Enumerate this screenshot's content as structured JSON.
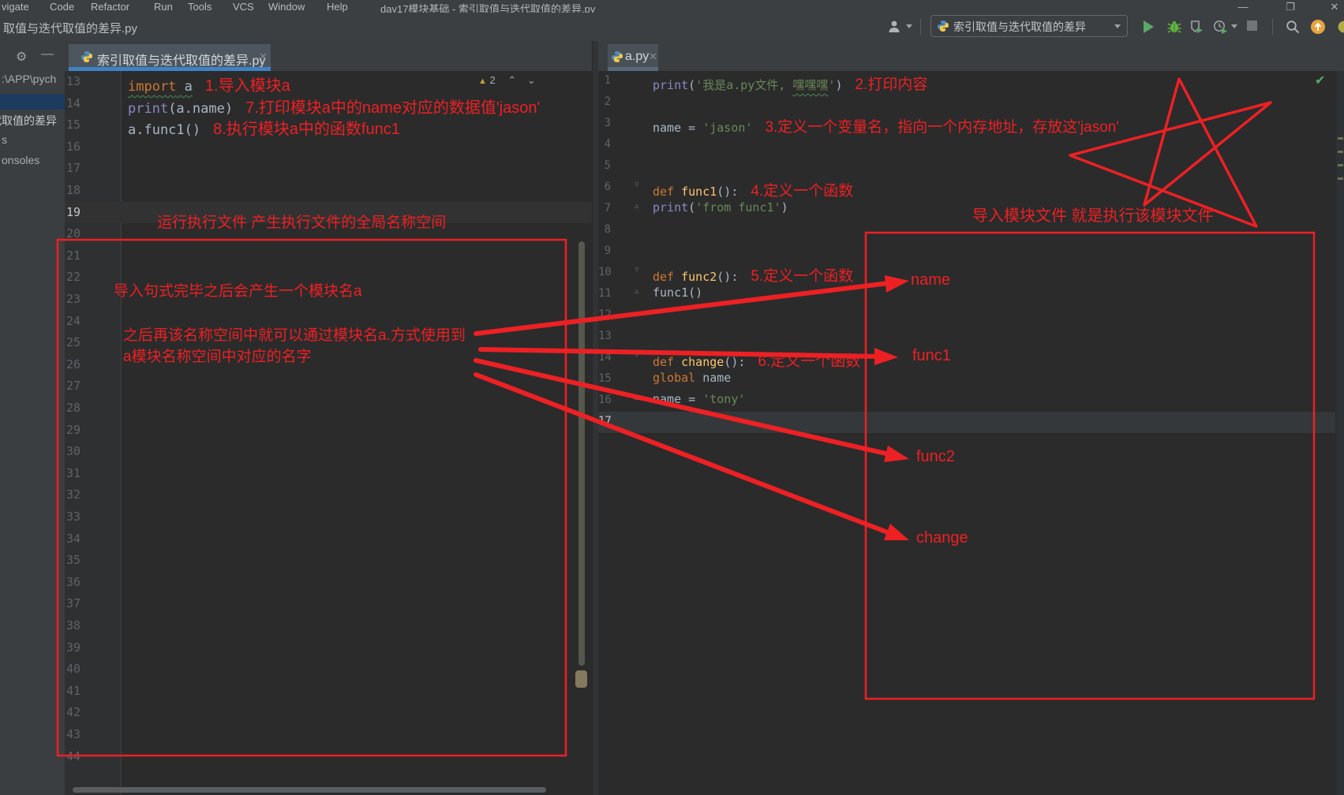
{
  "menu": {
    "items": [
      "vigate",
      "Code",
      "Refactor",
      "Run",
      "Tools",
      "VCS",
      "Window",
      "Help"
    ]
  },
  "window": {
    "title": "day17模块基础 - 索引取值与迭代取值的差异.py"
  },
  "toolbar": {
    "breadcrumb": "取值与迭代取值的差异.py",
    "run_config": "索引取值与迭代取值的差异"
  },
  "project": {
    "path": ":\\APP\\pych",
    "item_module": "代取值的差异",
    "item_s": "s",
    "item_consoles": "onsoles"
  },
  "tabs": {
    "left": "索引取值与迭代取值的差异.py",
    "right": "a.py"
  },
  "left_editor": {
    "warn_count": "2"
  },
  "red": {
    "run_note": "运行执行文件 产生执行文件的全局名称空间",
    "import_note": "导入句式完毕之后会产生一个模块名a",
    "use_note1": "之后再该名称空间中就可以通过模块名a.方式使用到",
    "use_note2": "a模块名称空间中对应的名字",
    "module_note": "导入模块文件 就是执行该模块文件",
    "label_name": "name",
    "label_func1": "func1",
    "label_func2": "func2",
    "label_change": "change"
  },
  "code": {
    "left": {
      "start": 13,
      "end": 44,
      "current": 19,
      "lines": {
        "13": {
          "tokens": [
            [
              "kw wavy",
              "import"
            ],
            [
              "pl wavy",
              " a"
            ]
          ],
          "ann": "1.导入模块a"
        },
        "14": {
          "tokens": [
            [
              "bi",
              "print"
            ],
            [
              "pl",
              "(a.name)"
            ]
          ],
          "ann": "7.打印模块a中的name对应的数据值'jason'"
        },
        "15": {
          "tokens": [
            [
              "pl",
              "a.func1()"
            ]
          ],
          "ann": "8.执行模块a中的函数func1"
        }
      }
    },
    "right": {
      "start": 1,
      "end": 17,
      "current": 17,
      "lines": {
        "1": {
          "tokens": [
            [
              "bi",
              "print"
            ],
            [
              "pl",
              "("
            ],
            [
              "str",
              "'我是a.py文件, "
            ],
            [
              "str wavy",
              "嘿嘿嘿"
            ],
            [
              "str",
              "'"
            ],
            [
              "pl",
              ")"
            ]
          ],
          "ann": "2.打印内容"
        },
        "3": {
          "tokens": [
            [
              "pl",
              "name = "
            ],
            [
              "str",
              "'jason'"
            ]
          ],
          "ann": "3.定义一个变量名，指向一个内存地址，存放这'jason'"
        },
        "6": {
          "tokens": [
            [
              "kw",
              "def "
            ],
            [
              "fn",
              "func1"
            ],
            [
              "pl",
              "():"
            ]
          ],
          "ann": "4.定义一个函数",
          "fold": "d"
        },
        "7": {
          "tokens": [
            [
              "pl",
              "    "
            ],
            [
              "bi",
              "print"
            ],
            [
              "pl",
              "("
            ],
            [
              "str",
              "'from func1'"
            ],
            [
              "pl",
              ")"
            ]
          ],
          "fold": "u"
        },
        "10": {
          "tokens": [
            [
              "kw",
              "def "
            ],
            [
              "fn",
              "func2"
            ],
            [
              "pl",
              "():"
            ]
          ],
          "ann": "5.定义一个函数",
          "fold": "d"
        },
        "11": {
          "tokens": [
            [
              "pl",
              "    func1()"
            ]
          ],
          "fold": "u"
        },
        "14": {
          "tokens": [
            [
              "kw",
              "def "
            ],
            [
              "fn",
              "change"
            ],
            [
              "pl",
              "():"
            ]
          ],
          "ann": "6.定义一个函数",
          "fold": "d"
        },
        "15": {
          "tokens": [
            [
              "pl",
              "    "
            ],
            [
              "kw",
              "global"
            ],
            [
              "pl",
              " name"
            ]
          ]
        },
        "16": {
          "tokens": [
            [
              "pl",
              "    name = "
            ],
            [
              "str",
              "'tony'"
            ]
          ],
          "fold": "u"
        }
      }
    }
  }
}
